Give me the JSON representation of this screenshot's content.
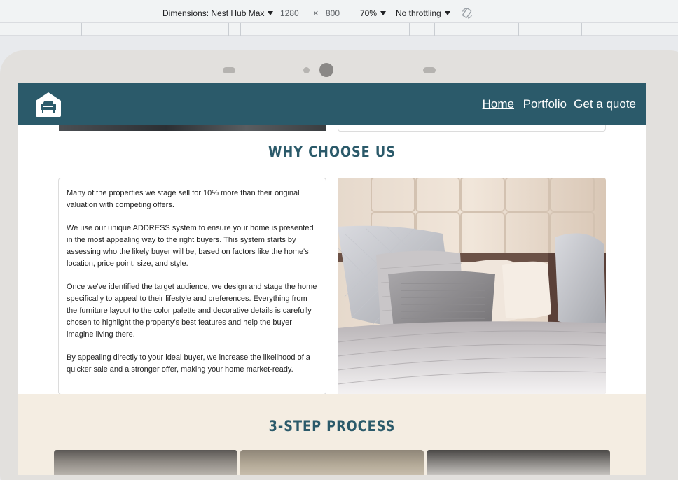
{
  "devtools": {
    "dimensions_label": "Dimensions: Nest Hub Max",
    "width": "1280",
    "times": "×",
    "height": "800",
    "zoom": "70%",
    "throttling": "No throttling",
    "rotate_icon": "rotate-icon"
  },
  "site": {
    "logo_icon": "armchair-house-icon",
    "nav": {
      "home": "Home",
      "portfolio": "Portfolio",
      "quote": "Get a quote"
    },
    "why_title": "WHY CHOOSE US",
    "why_paragraphs": {
      "p1": "Many of the properties we stage sell for 10% more than their original valuation with competing offers.",
      "p2": "We use our unique ADDRESS system to ensure your home is presented in the most appealing way to the right buyers. This system starts by assessing who the likely buyer will be, based on factors like the home's location, price point, size, and style.",
      "p3": "Once we've identified the target audience, we design and stage the home specifically to appeal to their lifestyle and preferences. Everything from the furniture layout to the color palette and decorative details is carefully chosen to highlight the property's best features and help the buyer imagine living there.",
      "p4": "By appealing directly to your ideal buyer, we increase the likelihood of a quicker sale and a stronger offer, making your home market-ready."
    },
    "process_title": "3-STEP PROCESS",
    "colors": {
      "brand": "#2b5a6a",
      "process_bg": "#f4ede2"
    }
  }
}
